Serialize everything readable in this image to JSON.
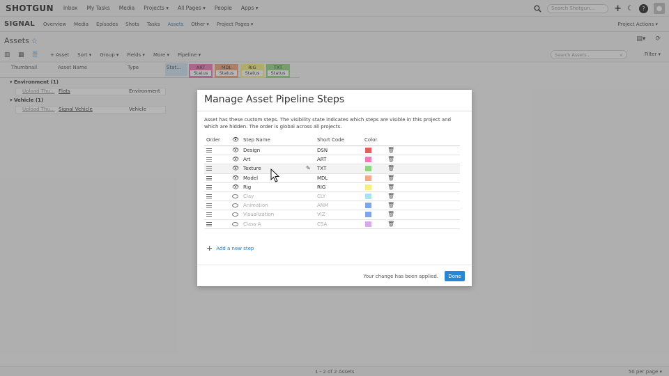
{
  "topnav": {
    "logo": "SHOTGUN",
    "items": [
      "Inbox",
      "My Tasks",
      "Media",
      "Projects ▾",
      "All Pages ▾",
      "People",
      "Apps ▾"
    ],
    "search_placeholder": "Search Shotgun..."
  },
  "projnav": {
    "project": "SIGNAL",
    "items": [
      "Overview",
      "Media",
      "Episodes",
      "Shots",
      "Tasks",
      "Assets",
      "Other ▾",
      "Project Pages ▾"
    ],
    "active": "Assets",
    "actions": "Project Actions ▾"
  },
  "page": {
    "title": "Assets"
  },
  "toolbar": {
    "items": [
      "+ Asset",
      "Sort ▾",
      "Group ▾",
      "Fields ▾",
      "More ▾",
      "Pipeline ▾"
    ],
    "search_placeholder": "Search Assets...",
    "filter": "Filter ▾"
  },
  "grid": {
    "headers": {
      "thumbnail": "Thumbnail",
      "asset_name": "Asset Name",
      "type": "Type",
      "status": "Stat..."
    },
    "pipeline_cols": [
      {
        "name": "ART",
        "sub": "Status",
        "color": "#e879b6"
      },
      {
        "name": "MDL",
        "sub": "Status",
        "color": "#f0a07a"
      },
      {
        "name": "RIG",
        "sub": "Status",
        "color": "#f5ef80"
      },
      {
        "name": "TXT",
        "sub": "Status",
        "color": "#8fd67e"
      }
    ],
    "groups": [
      {
        "label": "Environment (1)",
        "row": {
          "thumb": "Upload Thu...",
          "name": "Flats",
          "type": "Environment"
        }
      },
      {
        "label": "Vehicle (1)",
        "row": {
          "thumb": "Upload Thu...",
          "name": "Signal Vehicle",
          "type": "Vehicle"
        }
      }
    ]
  },
  "modal": {
    "title": "Manage Asset Pipeline Steps",
    "description": "Asset has these custom steps. The visibility state indicates which steps are visible in this project and which are hidden. The order is global across all projects.",
    "columns": {
      "order": "Order",
      "name": "Step Name",
      "code": "Short Code",
      "color": "Color"
    },
    "steps": [
      {
        "name": "Design",
        "code": "DSN",
        "color": "#e06060",
        "visible": true
      },
      {
        "name": "Art",
        "code": "ART",
        "color": "#ee7ab8",
        "visible": true
      },
      {
        "name": "Texture",
        "code": "TXT",
        "color": "#8fd67e",
        "visible": true,
        "hover": true
      },
      {
        "name": "Model",
        "code": "MDL",
        "color": "#f2a98a",
        "visible": true
      },
      {
        "name": "Rig",
        "code": "RIG",
        "color": "#f5ef80",
        "visible": true
      },
      {
        "name": "Clay",
        "code": "CLY",
        "color": "#a9e3f0",
        "visible": false
      },
      {
        "name": "Animation",
        "code": "ANM",
        "color": "#7ea6e8",
        "visible": false
      },
      {
        "name": "Visualization",
        "code": "VIZ",
        "color": "#7ea6e8",
        "visible": false
      },
      {
        "name": "Class-A",
        "code": "CSA",
        "color": "#d8a9ef",
        "visible": false
      }
    ],
    "add_step": "Add a new step",
    "status": "Your change has been applied.",
    "done": "Done"
  },
  "statusbar": {
    "count": "1 - 2 of 2 Assets",
    "per_page": "50 per page ▾"
  }
}
